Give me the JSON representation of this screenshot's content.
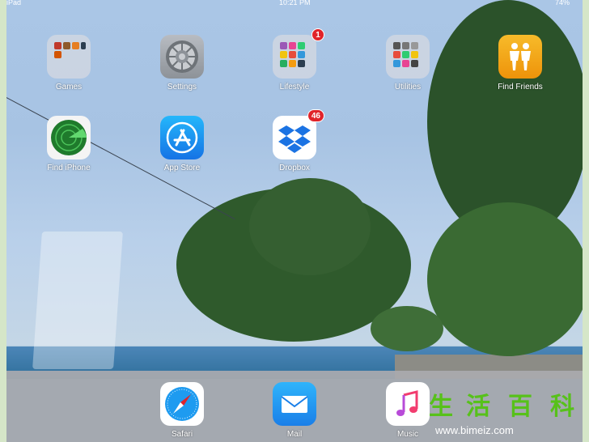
{
  "status_bar": {
    "carrier": "iPad",
    "time": "10:21 PM",
    "battery": "74%"
  },
  "home_apps": [
    {
      "label": "Games",
      "icon": "games-folder-icon"
    },
    {
      "label": "Settings",
      "icon": "settings-gear-icon"
    },
    {
      "label": "Lifestyle",
      "icon": "lifestyle-folder-icon",
      "badge": "1"
    },
    {
      "label": "Utilities",
      "icon": "utilities-folder-icon"
    },
    {
      "label": "Find Friends",
      "icon": "find-friends-icon"
    },
    {
      "label": "Find iPhone",
      "icon": "find-iphone-radar-icon"
    },
    {
      "label": "App Store",
      "icon": "app-store-icon"
    },
    {
      "label": "Dropbox",
      "icon": "dropbox-icon",
      "badge": "46"
    }
  ],
  "dock_apps": [
    {
      "label": "Safari",
      "icon": "safari-compass-icon"
    },
    {
      "label": "Mail",
      "icon": "mail-envelope-icon"
    },
    {
      "label": "Music",
      "icon": "music-note-icon"
    }
  ],
  "watermark": {
    "chars": [
      "生",
      "活",
      "百",
      "科"
    ],
    "url": "www.bimeiz.com"
  },
  "colors": {
    "badge": "#e0232a",
    "find_friends": "#f2a30f",
    "app_store": "#1d8cf0",
    "dropbox": "#1b73e3",
    "dock": "#aaaaaf"
  }
}
